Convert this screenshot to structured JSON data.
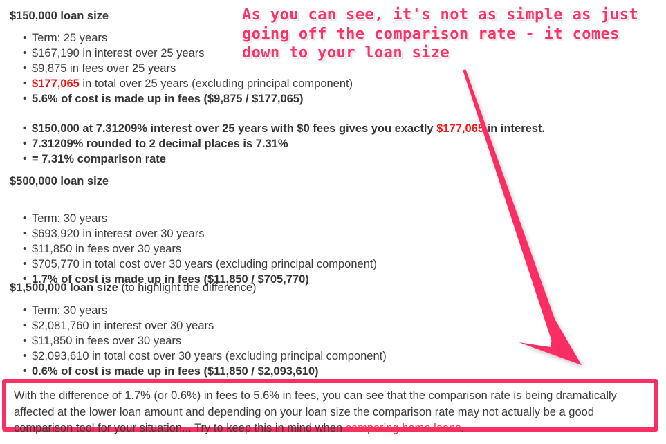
{
  "colors": {
    "accent_pink": "#fa2f63",
    "annotation_pink": "#fa3468",
    "highlight_red": "#f41414",
    "link_red": "#f23550",
    "body_text": "#3a3a3a",
    "heading_text": "#343434",
    "background": "#ffffff"
  },
  "annotation": {
    "text": "As you can see, it's not as simple as just\ngoing off the comparison rate - it comes\ndown to your loan size"
  },
  "sections": [
    {
      "heading": "$150,000 loan size",
      "heading_suffix": "",
      "groups": [
        {
          "items": [
            {
              "text": "Term: 25 years",
              "bold": false
            },
            {
              "text": "$167,190 in interest over 25 years",
              "bold": false
            },
            {
              "text": "$9,875 in fees over 25 years",
              "bold": false
            },
            {
              "pre": "",
              "highlight": "$177,065",
              "post": " in total over 25 years (excluding principal component)",
              "bold": false
            },
            {
              "text": "5.6% of cost is made up in fees ($9,875 / $177,065)",
              "bold": true
            }
          ]
        },
        {
          "items": [
            {
              "pre": "$150,000 at 7.31209% interest over 25 years with $0 fees gives you exactly ",
              "highlight": "$177,065",
              "post": " in interest.",
              "bold": true
            },
            {
              "text": "7.31209% rounded to 2 decimal places is 7.31%",
              "bold": true
            },
            {
              "text": "= 7.31% comparison rate",
              "bold": true
            }
          ]
        }
      ]
    },
    {
      "heading": "$500,000 loan size",
      "heading_suffix": "",
      "groups": [
        {
          "items": [
            {
              "text": "Term: 30 years",
              "bold": false
            },
            {
              "text": "$693,920 in interest over 30 years",
              "bold": false
            },
            {
              "text": "$11,850 in fees over 30 years",
              "bold": false
            },
            {
              "text": "$705,770 in total cost over 30 years (excluding principal component)",
              "bold": false
            },
            {
              "text": "1.7% of cost is made up in fees ($11,850 / $705,770)",
              "bold": true
            }
          ]
        }
      ]
    },
    {
      "heading": "$1,500,000 loan size",
      "heading_suffix": " (to highlight the difference)",
      "groups": [
        {
          "items": [
            {
              "text": "Term: 30 years",
              "bold": false
            },
            {
              "text": "$2,081,760 in interest over 30 years",
              "bold": false
            },
            {
              "text": "$11,850 in fees over 30 years",
              "bold": false
            },
            {
              "text": "$2,093,610 in total cost over 30 years (excluding principal component)",
              "bold": false
            },
            {
              "text": "0.6% of cost is made up in fees ($11,850 / $2,093,610)",
              "bold": true
            }
          ]
        }
      ]
    }
  ],
  "callout": {
    "text_before_link": "With the difference of 1.7% (or 0.6%) in fees to 5.6% in fees, you can see that the comparison rate is being dramatically affected at the lower loan amount and depending on your loan size the comparison rate may not actually be a good comparison tool for your situation... Try to keep this in mind when ",
    "link_text": "comparing home loans",
    "text_after_link": "."
  }
}
